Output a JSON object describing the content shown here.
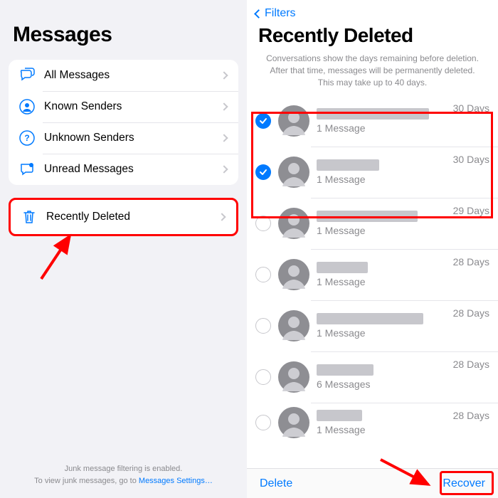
{
  "left": {
    "title": "Messages",
    "filters": [
      {
        "label": "All Messages"
      },
      {
        "label": "Known Senders"
      },
      {
        "label": "Unknown Senders"
      },
      {
        "label": "Unread Messages"
      }
    ],
    "recently_deleted_label": "Recently Deleted",
    "footer1": "Junk message filtering is enabled.",
    "footer2_prefix": "To view junk messages, go to ",
    "footer2_link": "Messages Settings…"
  },
  "right": {
    "back_label": "Filters",
    "title": "Recently Deleted",
    "info": "Conversations show the days remaining before deletion. After that time, messages will be permanently deleted. This may take up to 40 days.",
    "conversations": [
      {
        "selected": true,
        "name_width": 158,
        "sub": "1 Message",
        "days": "30 Days"
      },
      {
        "selected": true,
        "name_width": 88,
        "sub": "1 Message",
        "days": "30 Days"
      },
      {
        "selected": false,
        "name_width": 142,
        "sub": "1 Message",
        "days": "29 Days"
      },
      {
        "selected": false,
        "name_width": 72,
        "sub": "1 Message",
        "days": "28 Days"
      },
      {
        "selected": false,
        "name_width": 150,
        "sub": "1 Message",
        "days": "28 Days"
      },
      {
        "selected": false,
        "name_width": 80,
        "sub": "6 Messages",
        "days": "28 Days"
      },
      {
        "selected": false,
        "name_width": 64,
        "sub": "1 Message",
        "days": "28 Days"
      }
    ],
    "delete_label": "Delete",
    "recover_label": "Recover"
  }
}
